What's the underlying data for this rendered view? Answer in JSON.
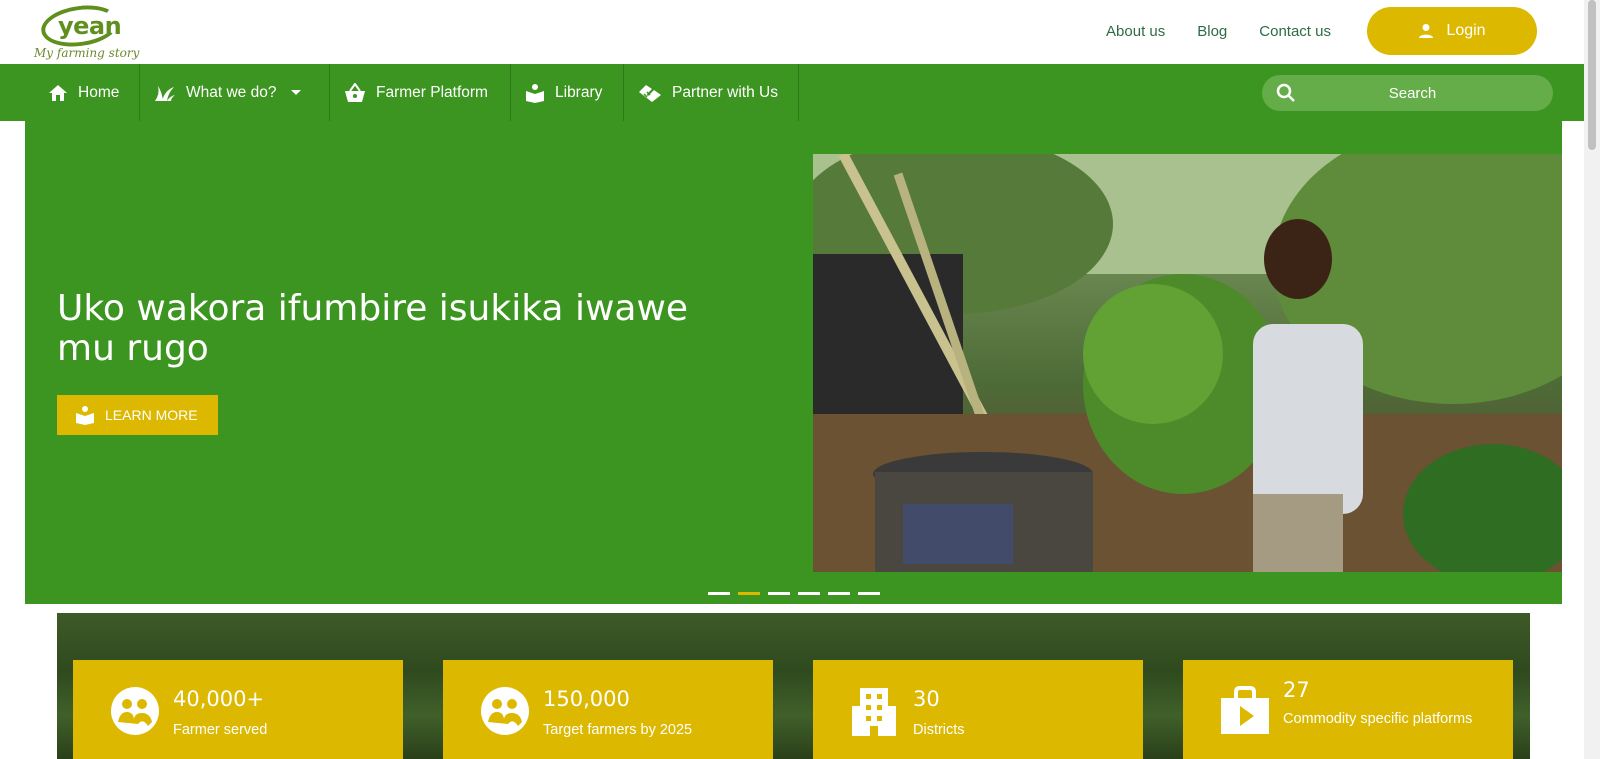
{
  "logo": {
    "word": "yean",
    "tagline": "My farming story"
  },
  "header": {
    "links": [
      "About us",
      "Blog",
      "Contact us"
    ],
    "login_label": "Login"
  },
  "nav": {
    "items": [
      {
        "label": "Home",
        "icon": "home-icon"
      },
      {
        "label": "What we do?",
        "icon": "grass-icon"
      },
      {
        "label": "Farmer Platform",
        "icon": "basket-icon"
      },
      {
        "label": "Library",
        "icon": "book-icon"
      },
      {
        "label": "Partner with Us",
        "icon": "handshake-icon"
      }
    ],
    "search_label": "Search"
  },
  "hero": {
    "title": "Uko wakora ifumbire isukika iwawe mu rugo",
    "button_label": "LEARN MORE",
    "slides_count": 6,
    "active_slide": 2
  },
  "stats": [
    {
      "value": "40,000+",
      "label": "Farmer served",
      "icon": "people-icon"
    },
    {
      "value": "150,000",
      "label": "Target farmers by 2025",
      "icon": "people-icon"
    },
    {
      "value": "30",
      "label": "Districts",
      "icon": "building-icon"
    },
    {
      "value": "27",
      "label": "Commodity specific platforms",
      "icon": "play-bag-icon"
    }
  ],
  "colors": {
    "green": "#3c9520",
    "yellow": "#dcb800",
    "link": "#2e6b45"
  }
}
